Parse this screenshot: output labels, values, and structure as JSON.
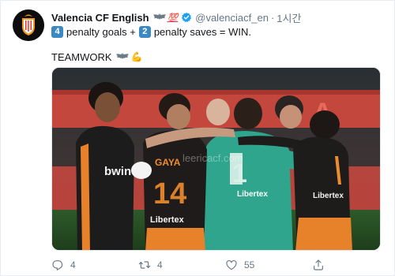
{
  "tweet": {
    "display_name": "Valencia CF English",
    "name_emoji_1": "bat-emoji",
    "name_emoji_2": "💯",
    "verified_icon": "verified-badge-icon",
    "handle": "@valenciacf_en",
    "separator": "·",
    "time": "1시간",
    "line1": {
      "key1": "4",
      "text1": "penalty goals +",
      "key2": "2",
      "text2": "penalty saves = WIN."
    },
    "line2": {
      "text": "TEAMWORK",
      "emoji_bat": "bat-emoji",
      "emoji_muscle": "💪"
    },
    "photo": {
      "description_icon": "team-celebration-photo",
      "jersey_name": "GAYA",
      "jersey_sponsor": "Libertex",
      "jersey_sponsor_2": "Libertex",
      "jersey_sponsor_3": "Libertex",
      "jersey_number": "1",
      "jersey_number_2": "14",
      "bwin": "bwin",
      "banner_text": "A",
      "watermark": "leericacf.com"
    },
    "actions": {
      "reply_count": "4",
      "retweet_count": "4",
      "like_count": "55",
      "reply_icon": "reply-icon",
      "retweet_icon": "retweet-icon",
      "like_icon": "heart-icon",
      "share_icon": "share-icon"
    }
  },
  "colors": {
    "primary_text": "#14171a",
    "secondary_text": "#657786",
    "verified_blue": "#1da1f2",
    "keycap_blue": "#3b88c3",
    "valencia_orange": "#f08c2e"
  }
}
